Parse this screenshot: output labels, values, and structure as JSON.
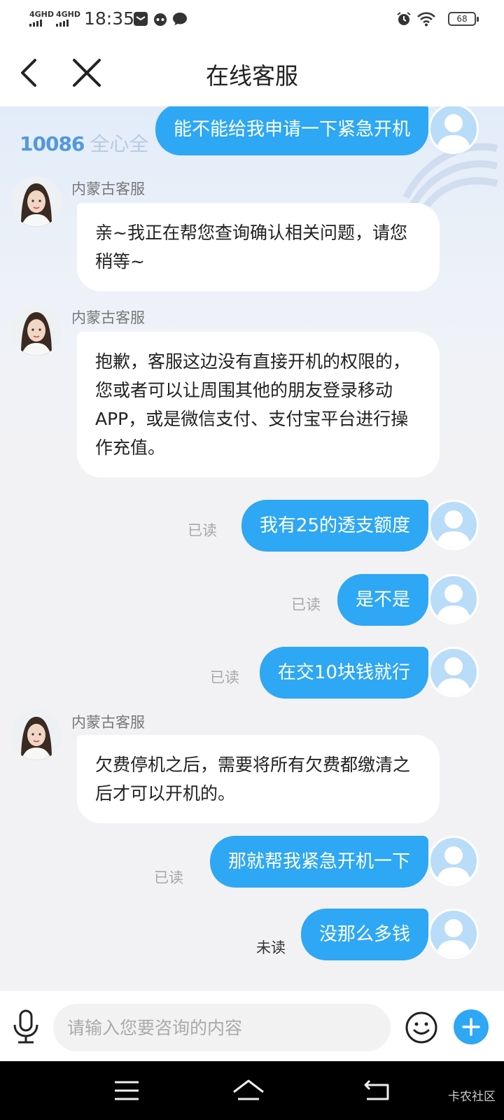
{
  "status": {
    "signal1": "4GHD",
    "signal2": "4GHD",
    "time": "18:35",
    "battery": "68"
  },
  "header": {
    "title": "在线客服"
  },
  "watermark": {
    "number": "10086",
    "text": "全心全"
  },
  "messages": [
    {
      "from": "user",
      "text": "能不能给我申请一下紧急开机"
    },
    {
      "from": "agent",
      "name": "内蒙古客服",
      "text": "亲~我正在帮您查询确认相关问题，请您稍等~"
    },
    {
      "from": "agent",
      "name": "内蒙古客服",
      "text": "抱歉，客服这边没有直接开机的权限的，您或者可以让周围其他的朋友登录移动APP，或是微信支付、支付宝平台进行操作充值。"
    },
    {
      "from": "user",
      "text": "我有25的透支额度",
      "status": "已读"
    },
    {
      "from": "user",
      "text": "是不是",
      "status": "已读"
    },
    {
      "from": "user",
      "text": "在交10块钱就行",
      "status": "已读"
    },
    {
      "from": "agent",
      "name": "内蒙古客服",
      "text": "欠费停机之后，需要将所有欠费都缴清之后才可以开机的。"
    },
    {
      "from": "user",
      "text": "那就帮我紧急开机一下",
      "status": "已读"
    },
    {
      "from": "user",
      "text": "没那么多钱",
      "status": "未读"
    }
  ],
  "input": {
    "placeholder": "请输入您要咨询的内容",
    "value": ""
  },
  "footer": {
    "brand": "卡农社区"
  },
  "colors": {
    "accent": "#2ea7f4",
    "user_bubble_text": "#ffffff",
    "agent_bubble": "#ffffff",
    "background": "#f2f2f4"
  },
  "icons": {
    "back": "chevron-left-icon",
    "close": "close-icon",
    "mic": "microphone-icon",
    "emoji": "smiley-icon",
    "plus": "plus-icon",
    "nav_menu": "menu-icon",
    "nav_home": "home-icon",
    "nav_back": "return-icon"
  }
}
